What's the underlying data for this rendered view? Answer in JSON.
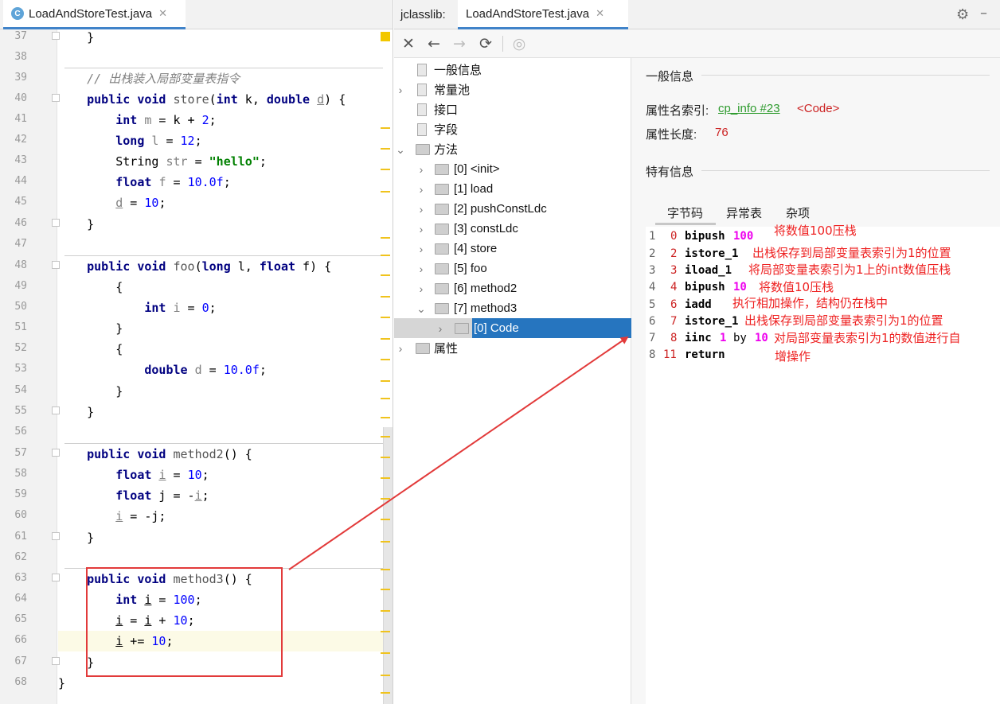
{
  "editor": {
    "tab": {
      "badge": "C",
      "label": "LoadAndStoreTest.java",
      "close": "✕"
    },
    "line_numbers": [
      "37",
      "38",
      "39",
      "40",
      "41",
      "42",
      "43",
      "44",
      "45",
      "46",
      "47",
      "48",
      "49",
      "50",
      "51",
      "52",
      "53",
      "54",
      "55",
      "56",
      "57",
      "58",
      "59",
      "60",
      "61",
      "62",
      "63",
      "64",
      "65",
      "66",
      "67",
      "68"
    ]
  },
  "code": {
    "l37": "}",
    "l39": "// 出栈装入局部变量表指令",
    "l40": {
      "kw1": "public",
      "kw2": "void",
      "name": "store",
      "p1": "(",
      "kw3": "int",
      "a1": " k, ",
      "kw4": "double",
      "sp": " ",
      "a2": "d",
      "end": ") {"
    },
    "l41": {
      "kw": "int",
      "v": "m",
      "mid": " = k + ",
      "n": "2",
      "end": ";"
    },
    "l42": {
      "kw": "long",
      "v": "l",
      "mid": " = ",
      "n": "12",
      "end": ";"
    },
    "l43": {
      "t": "String ",
      "v": "str",
      "mid": " = ",
      "s": "\"hello\"",
      "end": ";"
    },
    "l44": {
      "kw": "float",
      "v": "f",
      "mid": " = ",
      "n": "10.0f",
      "end": ";"
    },
    "l45": {
      "v": "d",
      "mid": " = ",
      "n": "10",
      "end": ";"
    },
    "l46": "}",
    "l48": {
      "kw1": "public",
      "kw2": "void",
      "name": "foo",
      "p1": "(",
      "kw3": "long",
      "a1": " l, ",
      "kw4": "float",
      "a2": " f) {"
    },
    "l49": "{",
    "l50": {
      "kw": "int",
      "v": "i",
      "mid": " = ",
      "n": "0",
      "end": ";"
    },
    "l51": "}",
    "l52": "{",
    "l53": {
      "kw": "double",
      "v": "d",
      "mid": " = ",
      "n": "10.0f",
      "end": ";"
    },
    "l54": "}",
    "l55": "}",
    "l57": {
      "kw1": "public",
      "kw2": "void",
      "name": "method2",
      "end": "() {"
    },
    "l58": {
      "kw": "float",
      "v": "i",
      "mid": " = ",
      "n": "10",
      "end": ";"
    },
    "l59": {
      "kw": "float",
      "rest": " j = -",
      "v": "i",
      "end": ";"
    },
    "l60": {
      "v": "i",
      "rest": " = -j;"
    },
    "l61": "}",
    "l63": {
      "kw1": "public",
      "kw2": "void",
      "name": "method3",
      "end": "() {"
    },
    "l64": {
      "kw": "int",
      "v": "i",
      "mid": " = ",
      "n": "100",
      "end": ";"
    },
    "l65": {
      "v1": "i",
      "mid": " = ",
      "v2": "i",
      "mid2": " + ",
      "n": "10",
      "end": ";"
    },
    "l66": {
      "v": "i",
      "mid": " += ",
      "n": "10",
      "end": ";"
    },
    "l67": "}",
    "l68": "}"
  },
  "jclasslib": {
    "prefix": "jclasslib:",
    "tab": {
      "label": "LoadAndStoreTest.java",
      "close": "✕"
    },
    "toolbar": {
      "close": "✕",
      "back": "←",
      "forward": "→",
      "refresh": "⟳",
      "web": "◎"
    },
    "tree": {
      "general": "一般信息",
      "constant_pool": "常量池",
      "interfaces": "接口",
      "fields": "字段",
      "methods": "方法",
      "method_items": [
        "[0] <init>",
        "[1] load",
        "[2] pushConstLdc",
        "[3] constLdc",
        "[4] store",
        "[5] foo",
        "[6] method2",
        "[7] method3"
      ],
      "code_item": "[0] Code",
      "attributes": "属性"
    },
    "detail": {
      "general_title": "一般信息",
      "attr_name_key": "属性名索引:",
      "attr_name_link": "cp_info #23",
      "attr_name_value": "<Code>",
      "attr_len_key": "属性长度:",
      "attr_len_value": "76",
      "specific_title": "特有信息",
      "tabs": [
        "字节码",
        "异常表",
        "杂项"
      ]
    },
    "bytecode": [
      {
        "idx": "1",
        "off": "0",
        "op": "bipush",
        "arg": "100",
        "note": "将数值100压栈"
      },
      {
        "idx": "2",
        "off": "2",
        "op": "istore_1",
        "arg": "",
        "note": "出栈保存到局部变量表索引为1的位置"
      },
      {
        "idx": "3",
        "off": "3",
        "op": "iload_1",
        "arg": "",
        "note": "将局部变量表索引为1上的int数值压栈"
      },
      {
        "idx": "4",
        "off": "4",
        "op": "bipush",
        "arg": "10",
        "note": "将数值10压栈"
      },
      {
        "idx": "5",
        "off": "6",
        "op": "iadd",
        "arg": "",
        "note": "执行相加操作，结构仍在栈中"
      },
      {
        "idx": "6",
        "off": "7",
        "op": "istore_1",
        "arg": "",
        "note": "出栈保存到局部变量表索引为1的位置"
      },
      {
        "idx": "7",
        "off": "8",
        "op": "iinc",
        "arg": "1",
        "by": "by",
        "arg2": "10",
        "note": "对局部变量表索引为1的数值进行自",
        "note2": "增操作"
      },
      {
        "idx": "8",
        "off": "11",
        "op": "return",
        "arg": "",
        "note": ""
      }
    ]
  },
  "colors": {
    "annotation": "#ee2222",
    "selection": "#2675bf",
    "keyword": "#000080",
    "number": "#0000ff",
    "string": "#008000"
  }
}
